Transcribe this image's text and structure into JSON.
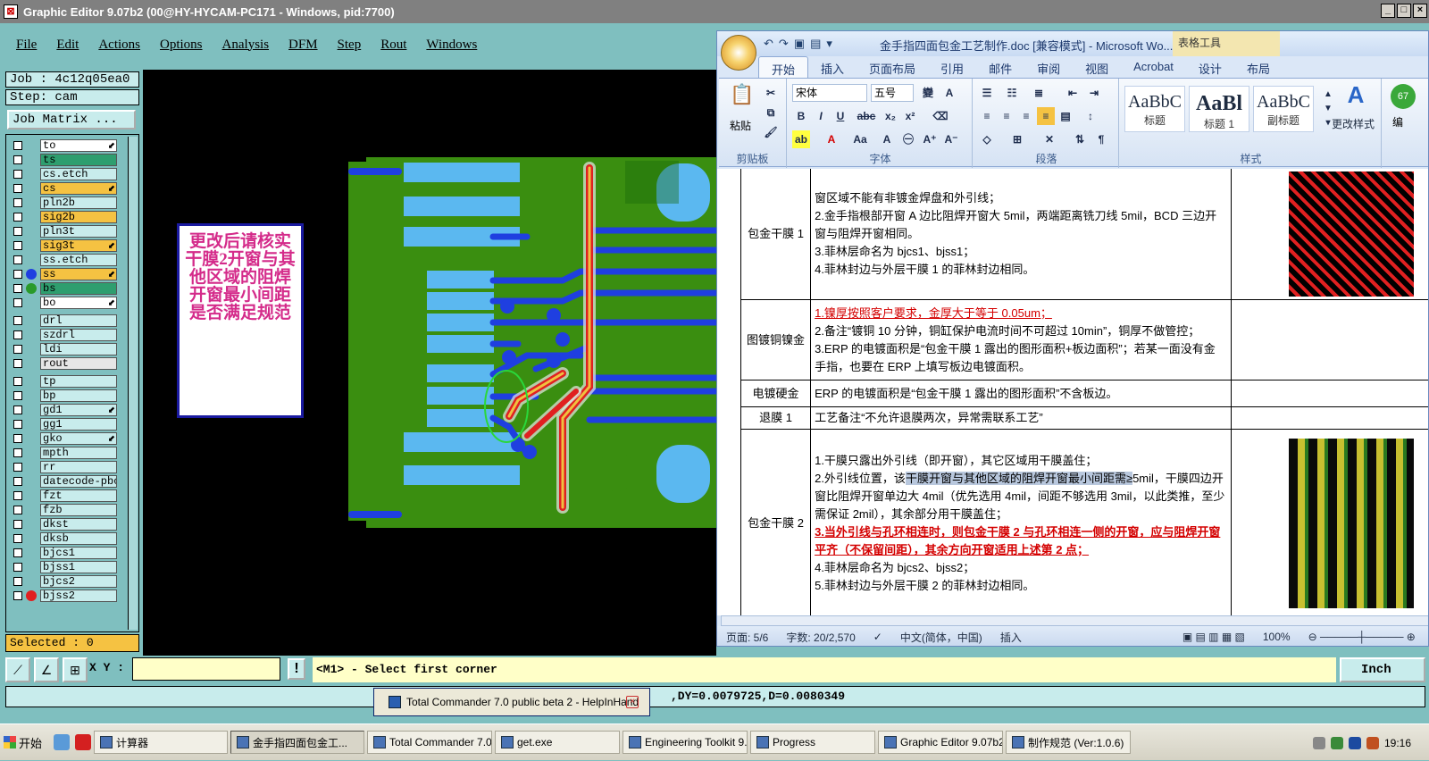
{
  "ge": {
    "title": "Graphic Editor 9.07b2 (00@HY-HYCAM-PC171 - Windows, pid:7700)",
    "menu": [
      "File",
      "Edit",
      "Actions",
      "Options",
      "Analysis",
      "DFM",
      "Step",
      "Rout",
      "Windows"
    ],
    "job_label": "Job : 4c12q05ea0",
    "step_label": "Step: cam",
    "job_matrix": "Job Matrix ...",
    "layers": [
      {
        "name": "to",
        "color": "#ffffff",
        "mark": "⬋"
      },
      {
        "name": "ts",
        "color": "#2e9e6f",
        "mark": ""
      },
      {
        "name": "cs.etch",
        "color": "#c8ecec",
        "mark": ""
      },
      {
        "name": "cs",
        "color": "#f5c242",
        "mark": "⬋"
      },
      {
        "name": "pln2b",
        "color": "#c8ecec",
        "mark": ""
      },
      {
        "name": "sig2b",
        "color": "#f5c242",
        "mark": ""
      },
      {
        "name": "pln3t",
        "color": "#c8ecec",
        "mark": ""
      },
      {
        "name": "sig3t",
        "color": "#f5c242",
        "mark": "⬋"
      },
      {
        "name": "ss.etch",
        "color": "#c8ecec",
        "mark": ""
      },
      {
        "name": "ss",
        "color": "#f5c242",
        "mark": "⬋",
        "dot": "#1f3fe0"
      },
      {
        "name": "bs",
        "color": "#2e9e6f",
        "mark": "",
        "dot": "#2a9a2a"
      },
      {
        "name": "bo",
        "color": "#ffffff",
        "mark": "⬋"
      },
      {
        "name": "drl",
        "color": "#c8ecec",
        "mark": ""
      },
      {
        "name": "szdrl",
        "color": "#c8ecec",
        "mark": ""
      },
      {
        "name": "ldi",
        "color": "#c8ecec",
        "mark": ""
      },
      {
        "name": "rout",
        "color": "#e6e6e6",
        "mark": ""
      },
      {
        "name": "tp",
        "color": "#c8ecec",
        "mark": ""
      },
      {
        "name": "bp",
        "color": "#c8ecec",
        "mark": ""
      },
      {
        "name": "gd1",
        "color": "#c8ecec",
        "mark": "⬋"
      },
      {
        "name": "gg1",
        "color": "#c8ecec",
        "mark": ""
      },
      {
        "name": "gko",
        "color": "#c8ecec",
        "mark": "⬋"
      },
      {
        "name": "mpth",
        "color": "#c8ecec",
        "mark": ""
      },
      {
        "name": "rr",
        "color": "#c8ecec",
        "mark": ""
      },
      {
        "name": "datecode-pbc",
        "color": "#c8ecec",
        "mark": ""
      },
      {
        "name": "fzt",
        "color": "#c8ecec",
        "mark": ""
      },
      {
        "name": "fzb",
        "color": "#c8ecec",
        "mark": ""
      },
      {
        "name": "dkst",
        "color": "#c8ecec",
        "mark": ""
      },
      {
        "name": "dksb",
        "color": "#c8ecec",
        "mark": ""
      },
      {
        "name": "bjcs1",
        "color": "#c8ecec",
        "mark": ""
      },
      {
        "name": "bjss1",
        "color": "#c8ecec",
        "mark": ""
      },
      {
        "name": "bjcs2",
        "color": "#c8ecec",
        "mark": ""
      },
      {
        "name": "bjss2",
        "color": "#c8ecec",
        "mark": "",
        "dot": "#e02020"
      }
    ],
    "selected": "Selected : 0",
    "note": "更改后请核实干膜2开窗与其他区域的阻焊开窗最小间距是否满足规范",
    "xy_label": "X Y :",
    "prompt": "<M1> - Select first corner",
    "units": "Inch",
    "status": ",DY=0.0079725,D=0.0080349",
    "popup": "Total Commander 7.0 public beta 2 - HelpInHand"
  },
  "word": {
    "title": "金手指四面包金工艺制作.doc [兼容模式] - Microsoft Wo...",
    "table_tools": "表格工具",
    "tabs": [
      "开始",
      "插入",
      "页面布局",
      "引用",
      "邮件",
      "审阅",
      "视图",
      "Acrobat",
      "设计",
      "布局"
    ],
    "font_name": "宋体",
    "font_size": "五号",
    "groups": {
      "clipboard": "剪贴板",
      "font": "字体",
      "para": "段落",
      "styles": "样式"
    },
    "paste": "粘贴",
    "styles": [
      {
        "big": "AaBbC",
        "label": "标题"
      },
      {
        "big": "AaBl",
        "label": "标题 1"
      },
      {
        "big": "AaBbC",
        "label": "副标题"
      }
    ],
    "change_styles": "更改样式",
    "edit_label": "编",
    "rows": [
      {
        "name": "包金干膜 1",
        "lines": [
          "窗区域不能有非镀金焊盘和外引线；",
          "2.金手指根部开窗 A 边比阻焊开窗大 5mil，两端距离铣刀线 5mil，BCD 三边开窗与阻焊开窗相同。",
          "3.菲林层命名为 bjcs1、bjss1；",
          "4.菲林封边与外层干膜 1 的菲林封边相同。"
        ]
      },
      {
        "name": "图镀铜镍金",
        "lines": [
          "1.镍厚按照客户要求，金厚大于等于 0.05um；",
          "2.备注“镀铜 10 分钟，铜缸保护电流时间不可超过 10min”，铜厚不做管控；",
          "3.ERP 的电镀面积是“包金干膜 1 露出的图形面积+板边面积”；若某一面没有金手指，也要在 ERP 上填写板边电镀面积。"
        ]
      },
      {
        "name": "电镀硬金",
        "lines": [
          "ERP 的电镀面积是“包金干膜 1 露出的图形面积”不含板边。"
        ]
      },
      {
        "name": "退膜 1",
        "lines": [
          "工艺备注“不允许退膜两次，异常需联系工艺”"
        ]
      },
      {
        "name": "包金干膜 2",
        "lines": [
          "1.干膜只露出外引线（即开窗），其它区域用干膜盖住；",
          "2.外引线位置，该",
          "干膜开窗与其他区域的阻焊开窗最小间距需≥",
          "5mil，干膜四边开窗比阻焊开窗单边大 4mil（优先选用 4mil，间距不够选用 3mil，以此类推，至少需保证 2mil），其余部分用干膜盖住；",
          "3.当外引线与孔环相连时，则包金干膜 2 与孔环相连一侧的开窗，应与阻焊开窗平齐（不保留间距），其余方向开窗适用上述第 2 点；",
          "4.菲林层命名为 bjcs2、bjss2；",
          "5.菲林封边与外层干膜 2 的菲林封边相同。"
        ]
      }
    ],
    "status": {
      "page": "页面: 5/6",
      "words": "字数: 20/2,570",
      "lang": "中文(简体，中国)",
      "mode": "插入",
      "zoom": "100%"
    }
  },
  "taskbar": {
    "start": "开始",
    "apps": [
      "计算器",
      "金手指四面包金工...",
      "Total Commander 7.0...",
      "get.exe",
      "Engineering Toolkit 9....",
      "Progress",
      "Graphic Editor 9.07b2...",
      "制作规范 (Ver:1.0.6)"
    ],
    "clock": "19:16"
  }
}
